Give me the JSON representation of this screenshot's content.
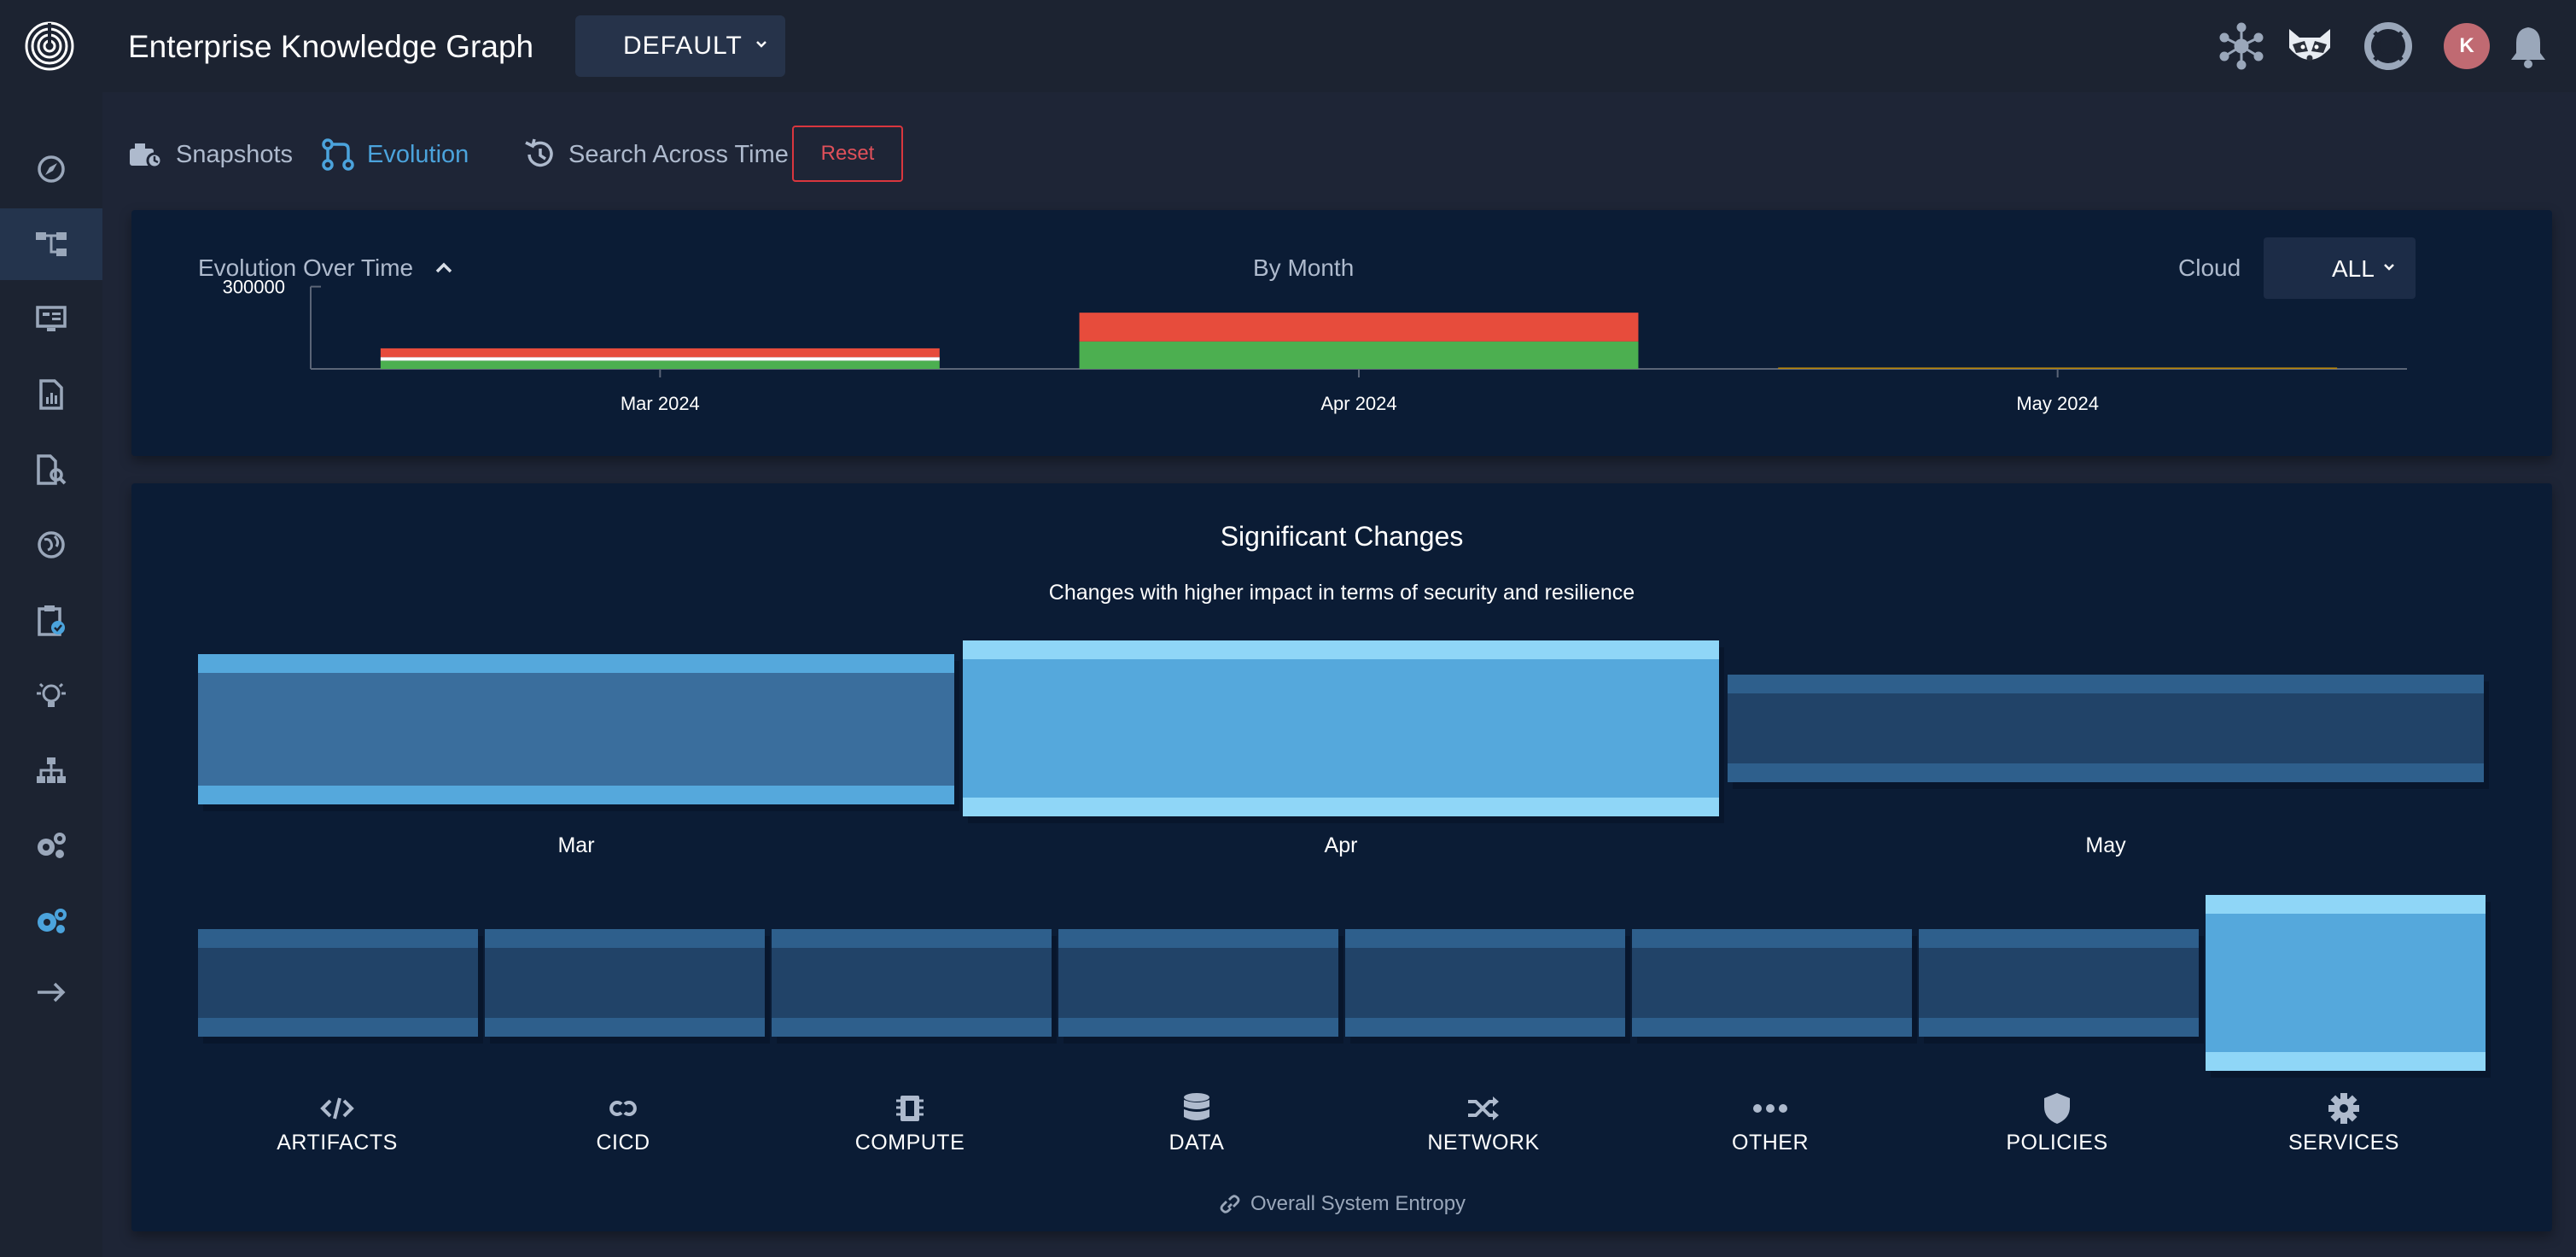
{
  "header": {
    "title": "Enterprise Knowledge Graph",
    "environment": "DEFAULT",
    "user_initial": "K"
  },
  "icons": {
    "top": [
      "network-graph-icon",
      "raccoon-mascot-icon",
      "lifebuoy-icon",
      "user-avatar",
      "bell-icon"
    ],
    "sidebar": [
      "compass-icon",
      "graph-icon",
      "monitor-icon",
      "report-icon",
      "document-search-icon",
      "globe-icon",
      "clipboard-check-icon",
      "lightbulb-icon",
      "hierarchy-icon",
      "gears-icon",
      "settings-icon",
      "arrow-right-icon"
    ]
  },
  "tabs": {
    "snapshots": "Snapshots",
    "evolution": "Evolution",
    "search_across_time": "Search Across Time",
    "reset": "Reset"
  },
  "evolution_panel": {
    "title": "Evolution Over Time",
    "granularity": "By Month",
    "cloud_label": "Cloud",
    "cloud_value": "ALL"
  },
  "significant_panel": {
    "title": "Significant Changes",
    "subtitle": "Changes with higher impact in terms of security and resilience",
    "footer": "Overall System Entropy"
  },
  "colors": {
    "red": "#e74c3c",
    "green": "#4caf50",
    "highlight": "#55a8dc",
    "dim": "#214368",
    "mid": "#3a6e9d"
  },
  "chart_data": [
    {
      "type": "bar",
      "title": "Evolution Over Time",
      "categories": [
        "Mar 2024",
        "Apr 2024",
        "May 2024"
      ],
      "y_tick_labels": [
        "300000"
      ],
      "ylim": [
        0,
        330000
      ],
      "series": [
        {
          "values": [
            45000,
            105000,
            5000
          ]
        },
        {
          "values": [
            30000,
            100000,
            0
          ]
        }
      ]
    },
    {
      "type": "heatmap",
      "title": "Significant Changes",
      "categories": [
        "Mar",
        "Apr",
        "May"
      ],
      "values": [
        0.6,
        1.0,
        0.25
      ]
    },
    {
      "type": "heatmap",
      "categories": [
        "ARTIFACTS",
        "CICD",
        "COMPUTE",
        "DATA",
        "NETWORK",
        "OTHER",
        "POLICIES",
        "SERVICES"
      ],
      "values": [
        0.1,
        0.1,
        0.1,
        0.1,
        0.1,
        0.1,
        0.1,
        1.0
      ]
    }
  ]
}
